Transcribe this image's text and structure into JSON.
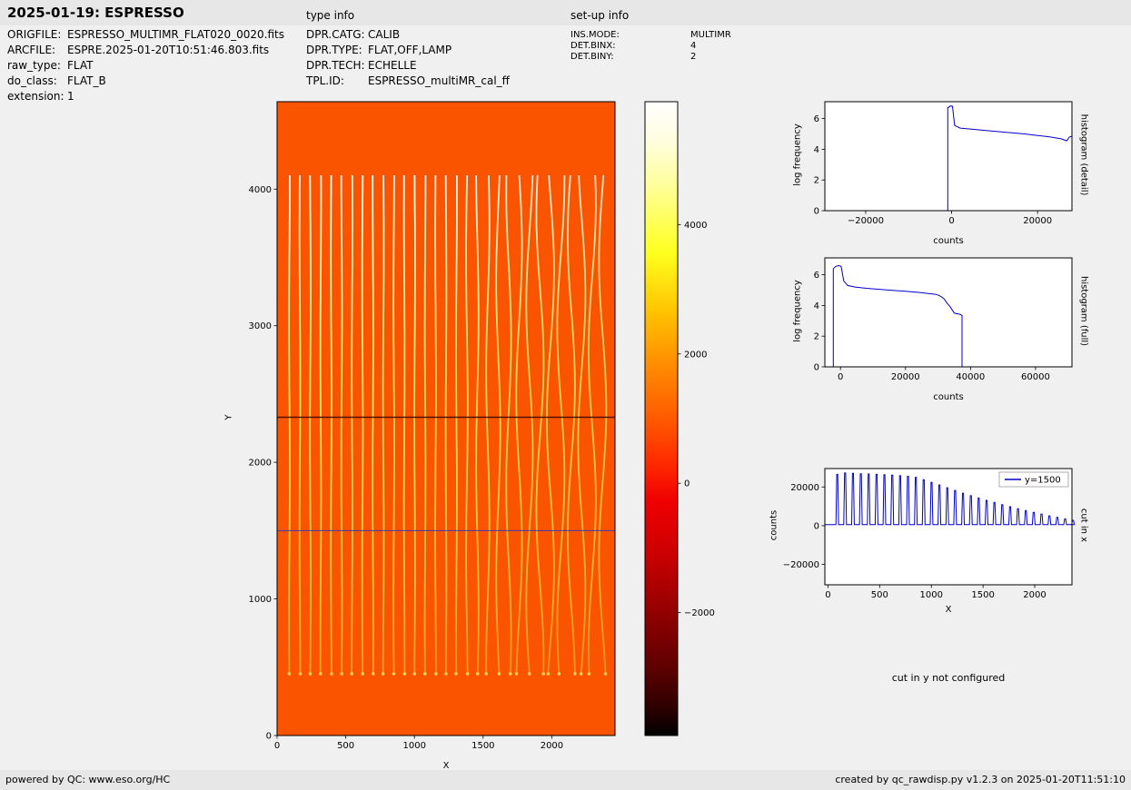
{
  "page": {
    "title": "2025-01-19: ESPRESSO",
    "type_info_heading": "type info",
    "setup_info_heading": "set-up info",
    "cut_y_note": "cut in y not configured",
    "footer_left": "powered by QC: www.eso.org/HC",
    "footer_right": "created by qc_rawdisp.py v1.2.3 on 2025-01-20T11:51:10"
  },
  "file_info": {
    "rows": [
      {
        "label": "ORIGFILE:",
        "value": "ESPRESSO_MULTIMR_FLAT020_0020.fits"
      },
      {
        "label": "ARCFILE:",
        "value": "ESPRE.2025-01-20T10:51:46.803.fits"
      },
      {
        "label": "raw_type:",
        "value": "FLAT"
      },
      {
        "label": "do_class:",
        "value": "FLAT_B"
      },
      {
        "label": "extension:",
        "value": "1"
      }
    ]
  },
  "type_info": {
    "rows": [
      {
        "label": "DPR.CATG:",
        "value": "CALIB"
      },
      {
        "label": "DPR.TYPE:",
        "value": "FLAT,OFF,LAMP"
      },
      {
        "label": "DPR.TECH:",
        "value": "ECHELLE"
      },
      {
        "label": "TPL.ID:",
        "value": "ESPRESSO_multiMR_cal_ff"
      }
    ]
  },
  "setup_info": {
    "rows": [
      {
        "label": "INS.MODE:",
        "value": "MULTIMR"
      },
      {
        "label": "DET.BINX:",
        "value": "4"
      },
      {
        "label": "DET.BINY:",
        "value": "2"
      }
    ]
  },
  "colors": {
    "image_bg": "#fb5400",
    "series_blue": "#0000cc"
  },
  "chart_data": [
    {
      "id": "raw_image",
      "type": "heatmap",
      "xlabel": "X",
      "ylabel": "Y",
      "xlim": [
        0,
        2460
      ],
      "ylim": [
        0,
        4640
      ],
      "xticks": [
        {
          "v": 0,
          "label": "0"
        },
        {
          "v": 500,
          "label": "500"
        },
        {
          "v": 1000,
          "label": "1000"
        },
        {
          "v": 1500,
          "label": "1500"
        },
        {
          "v": 2000,
          "label": "2000"
        }
      ],
      "yticks": [
        {
          "v": 0,
          "label": "0"
        },
        {
          "v": 1000,
          "label": "1000"
        },
        {
          "v": 2000,
          "label": "2000"
        },
        {
          "v": 3000,
          "label": "3000"
        },
        {
          "v": 4000,
          "label": "4000"
        }
      ],
      "colormap": "hot",
      "description": "raw flat-field frame: ~31 bright vertical echelle-order stripes on orange background",
      "stripes": {
        "y_range": [
          450,
          4100
        ],
        "x_from": "cut_in_x.spikes"
      },
      "hlines": [
        {
          "y": 2330,
          "color": "#501000",
          "width": 1.4,
          "name": "dark-detector-row"
        },
        {
          "y": 1500,
          "color": "#3a3ab8",
          "width": 1,
          "name": "cut-line-y1500"
        }
      ],
      "colorbar": {
        "vlim": [
          -3900,
          5900
        ],
        "ticks": [
          {
            "v": 4000,
            "label": "4000"
          },
          {
            "v": 2000,
            "label": "2000"
          },
          {
            "v": 0,
            "label": "0"
          },
          {
            "v": -2000,
            "label": "−2000"
          }
        ]
      }
    },
    {
      "id": "histogram_detail",
      "type": "line",
      "side_label": "histogram (detail)",
      "xlabel": "counts",
      "ylabel": "log frequency",
      "xlim": [
        -29500,
        28000
      ],
      "ylim": [
        0,
        7.1
      ],
      "xticks": [
        {
          "v": -20000,
          "label": "−20000"
        },
        {
          "v": 0,
          "label": "0"
        },
        {
          "v": 20000,
          "label": "20000"
        }
      ],
      "yticks": [
        {
          "v": 0,
          "label": "0"
        },
        {
          "v": 2,
          "label": "2"
        },
        {
          "v": 4,
          "label": "4"
        },
        {
          "v": 6,
          "label": "6"
        }
      ],
      "series": [
        {
          "name": "histogram",
          "color": "#0000cc",
          "x": [
            -2500,
            -900,
            -900,
            -300,
            200,
            700,
            2000,
            5000,
            8000,
            11000,
            14000,
            17000,
            20000,
            23000,
            25500,
            26800,
            27400,
            28000
          ],
          "y": [
            0,
            0,
            6.7,
            6.82,
            6.8,
            5.55,
            5.38,
            5.3,
            5.22,
            5.15,
            5.07,
            5.0,
            4.9,
            4.8,
            4.68,
            4.55,
            4.8,
            4.85
          ]
        }
      ]
    },
    {
      "id": "histogram_full",
      "type": "line",
      "side_label": "histogram (full)",
      "xlabel": "counts",
      "ylabel": "log frequency",
      "xlim": [
        -4800,
        71200
      ],
      "ylim": [
        0,
        7.1
      ],
      "xticks": [
        {
          "v": 0,
          "label": "0"
        },
        {
          "v": 20000,
          "label": "20000"
        },
        {
          "v": 40000,
          "label": "40000"
        },
        {
          "v": 60000,
          "label": "60000"
        }
      ],
      "yticks": [
        {
          "v": 0,
          "label": "0"
        },
        {
          "v": 2,
          "label": "2"
        },
        {
          "v": 4,
          "label": "4"
        },
        {
          "v": 6,
          "label": "6"
        }
      ],
      "series": [
        {
          "name": "histogram",
          "color": "#0000cc",
          "x": [
            -2200,
            -2200,
            -1400,
            -600,
            200,
            1000,
            2200,
            4500,
            8000,
            12000,
            16000,
            20000,
            24000,
            27000,
            29500,
            30800,
            31800,
            32800,
            33800,
            35000,
            36200,
            37000,
            37400,
            37400
          ],
          "y": [
            0,
            6.4,
            6.55,
            6.6,
            6.55,
            5.6,
            5.3,
            5.2,
            5.12,
            5.05,
            4.98,
            4.92,
            4.85,
            4.78,
            4.72,
            4.6,
            4.45,
            4.15,
            3.9,
            3.5,
            3.45,
            3.4,
            3.35,
            0
          ]
        }
      ]
    },
    {
      "id": "cut_in_x",
      "type": "line",
      "side_label": "cut in x",
      "xlabel": "X",
      "ylabel": "counts",
      "xlim": [
        -30,
        2360
      ],
      "ylim": [
        -30500,
        29500
      ],
      "xticks": [
        {
          "v": 0,
          "label": "0"
        },
        {
          "v": 500,
          "label": "500"
        },
        {
          "v": 1000,
          "label": "1000"
        },
        {
          "v": 1500,
          "label": "1500"
        },
        {
          "v": 2000,
          "label": "2000"
        }
      ],
      "yticks": [
        {
          "v": 20000,
          "label": "20000"
        },
        {
          "v": 0,
          "label": "0"
        },
        {
          "v": -20000,
          "label": "−20000"
        }
      ],
      "legend": [
        {
          "label": "y=1500",
          "color": "#0000cc"
        }
      ],
      "spikes": {
        "baseline": 600,
        "width": 26,
        "x": [
          90,
          166,
          242,
          318,
          394,
          470,
          546,
          622,
          698,
          774,
          850,
          926,
          1002,
          1078,
          1154,
          1230,
          1306,
          1382,
          1458,
          1534,
          1610,
          1686,
          1762,
          1838,
          1914,
          1990,
          2066,
          2142,
          2218,
          2294,
          2370
        ],
        "peak": [
          26500,
          27200,
          27000,
          26800,
          26700,
          26500,
          26300,
          26100,
          25800,
          25500,
          25000,
          23800,
          22400,
          21000,
          19600,
          18200,
          16800,
          15500,
          14300,
          13100,
          12000,
          10900,
          9800,
          8800,
          7800,
          6900,
          6000,
          5100,
          4300,
          3500,
          2800
        ]
      }
    }
  ]
}
